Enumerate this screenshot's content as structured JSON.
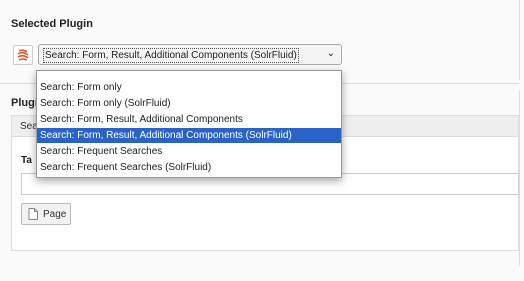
{
  "selected_plugin": {
    "title": "Selected Plugin",
    "select_value": "Search: Form, Result, Additional Components (SolrFluid)"
  },
  "dropdown": {
    "options": [
      "Search: Form only",
      "Search: Form only (SolrFluid)",
      "Search: Form, Result, Additional Components",
      "Search: Form, Result, Additional Components (SolrFluid)",
      "Search: Frequent Searches",
      "Search: Frequent Searches (SolrFluid)"
    ],
    "selected_index": 3
  },
  "plugin_options": {
    "title_visible": "Plugi",
    "tab_visible": "Sea",
    "target_label_visible": "Ta",
    "page_button": "Page"
  },
  "colors": {
    "selection": "#2a63c8",
    "plugin_icon": "#e0522f"
  },
  "icons": {
    "plugin": "solr-plugin-icon",
    "page": "page-icon",
    "arrow": "chevron-down-icon"
  }
}
